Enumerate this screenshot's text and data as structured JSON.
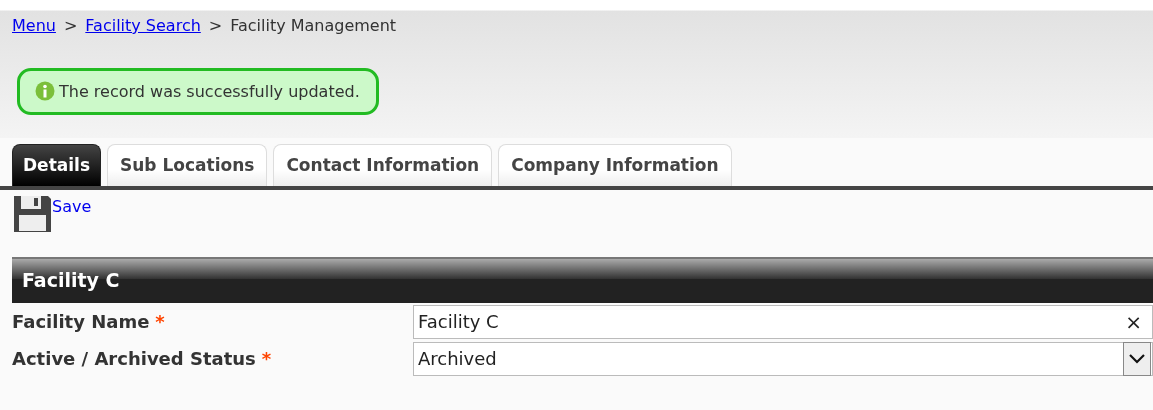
{
  "breadcrumb": {
    "links": [
      "Menu",
      "Facility Search"
    ],
    "separator": ">",
    "current": "Facility Management"
  },
  "message": {
    "text": "The record was successfully updated."
  },
  "tabs": [
    {
      "label": "Details",
      "selected": true
    },
    {
      "label": "Sub Locations",
      "selected": false
    },
    {
      "label": "Contact Information",
      "selected": false
    },
    {
      "label": "Company Information",
      "selected": false
    }
  ],
  "toolbar": {
    "save": "Save"
  },
  "section": {
    "title": "Facility C"
  },
  "fields": [
    {
      "kind": "text",
      "label": "Facility Name",
      "required_mark": "*",
      "value": "Facility C",
      "clear": "×"
    },
    {
      "kind": "select",
      "label": "Active / Archived Status",
      "required_mark": "*",
      "value": "Archived"
    }
  ]
}
